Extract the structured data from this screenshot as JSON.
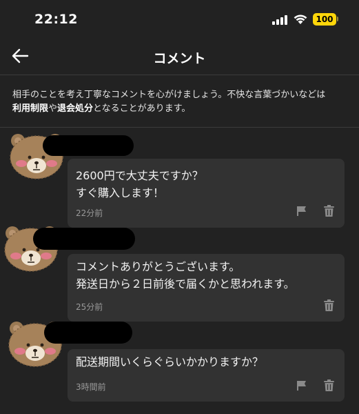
{
  "status_bar": {
    "time": "22:12",
    "battery": "100"
  },
  "nav": {
    "title": "コメント"
  },
  "notice": {
    "text_1": "相手のことを考え丁寧なコメントを心がけましょう。不快な言葉づかいなどは",
    "bold_1": "利用制限",
    "text_2": "や",
    "bold_2": "退会処分",
    "text_3": "となることがあります。"
  },
  "comments": [
    {
      "lines": [
        "2600円で大丈夫ですか？",
        "すぐ購入します！"
      ],
      "time": "22分前",
      "report_icon": true,
      "delete_icon": true
    },
    {
      "lines": [
        "コメントありがとうございます。",
        "発送日から２日前後で届くかと思われます。"
      ],
      "time": "25分前",
      "report_icon": false,
      "delete_icon": true
    },
    {
      "lines": [
        "配送期間いくらぐらいかかりますか？"
      ],
      "time": "3時間前",
      "report_icon": true,
      "delete_icon": true
    }
  ],
  "colors": {
    "background": "#222222",
    "bubble": "#323232",
    "battery": "#ffd60a",
    "avatar_fur": "#9b7a54"
  }
}
